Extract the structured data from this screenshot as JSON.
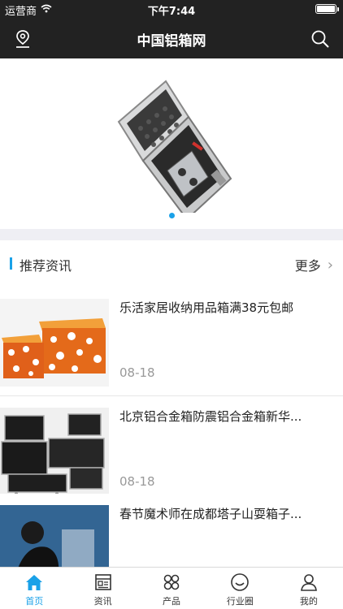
{
  "status_bar": {
    "carrier": "运营商",
    "time": "下午7:44"
  },
  "nav": {
    "title": "中国铝箱网",
    "location_icon": "location-pin-icon",
    "search_icon": "search-icon"
  },
  "banner": {
    "image": "aluminum-case-with-remote-control",
    "page_count": 1,
    "active_index": 0
  },
  "section": {
    "title": "推荐资讯",
    "more_label": "更多"
  },
  "news": [
    {
      "title": "乐活家居收纳用品箱满38元包邮",
      "date": "08-18",
      "thumb": "orange-floral-storage-boxes"
    },
    {
      "title": "北京铝合金箱防震铝合金箱新华...",
      "date": "08-18",
      "thumb": "black-flight-cases"
    },
    {
      "title": "春节魔术师在成都塔子山耍箱子...",
      "date": "",
      "thumb": "magician-on-stage"
    }
  ],
  "tabs": [
    {
      "label": "首页",
      "icon": "home-icon",
      "active": true
    },
    {
      "label": "资讯",
      "icon": "news-icon",
      "active": false
    },
    {
      "label": "产品",
      "icon": "products-grid-icon",
      "active": false
    },
    {
      "label": "行业圈",
      "icon": "circle-smile-icon",
      "active": false
    },
    {
      "label": "我的",
      "icon": "user-icon",
      "active": false
    }
  ],
  "colors": {
    "header_bg": "#222222",
    "accent": "#1aa1e8",
    "divider": "#efeff4"
  }
}
